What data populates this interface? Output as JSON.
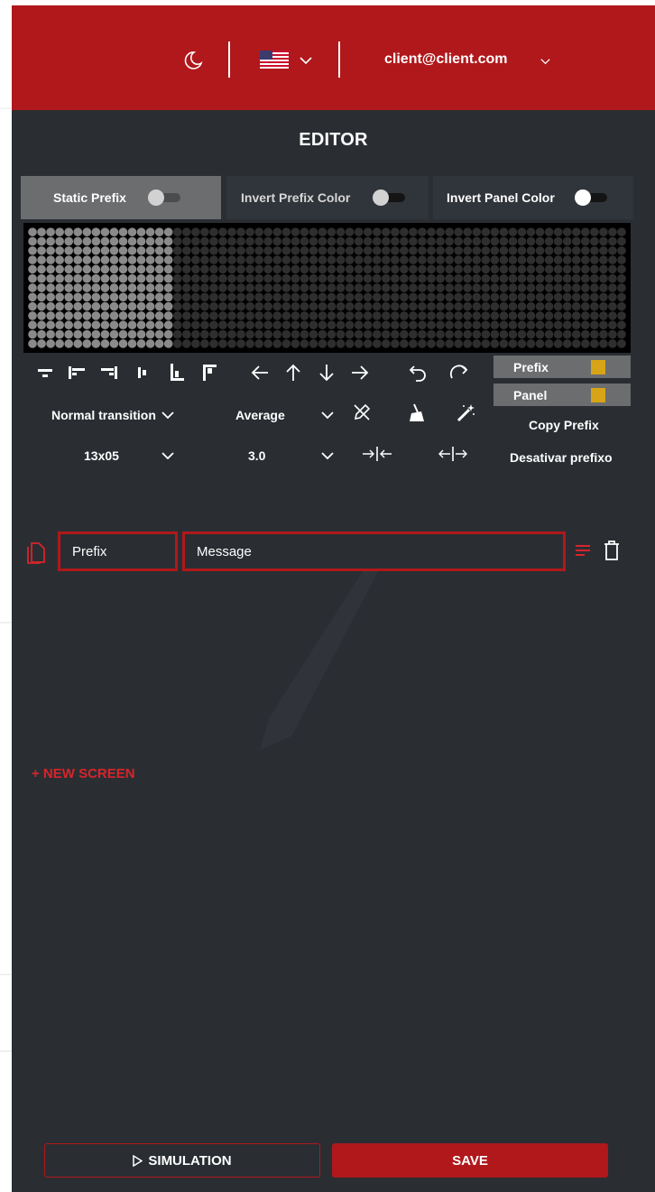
{
  "header": {
    "theme_icon": "moon-icon",
    "language_icon": "us-flag-icon",
    "user_email": "client@client.com",
    "colors": {
      "bar": "#b0181b"
    }
  },
  "editor": {
    "title": "EDITOR",
    "toggles": [
      {
        "label": "Static Prefix",
        "on": false,
        "active": true
      },
      {
        "label": "Invert Prefix Color",
        "on": false,
        "active": false
      },
      {
        "label": "Invert Panel Color",
        "on": false,
        "active": false
      }
    ],
    "led_panel": {
      "columns": 66,
      "rows": 13,
      "prefix_columns": 16,
      "prefix_dot_color": "#8a8a8a",
      "off_dot_color": "#2e2e2e"
    },
    "toolbar_icons": [
      "align-bottom-center-icon",
      "align-left-icon",
      "align-right-icon",
      "align-middle-left-icon",
      "align-bottom-left-icon",
      "align-top-left-icon",
      "arrow-left-icon",
      "arrow-up-icon",
      "arrow-down-icon",
      "arrow-right-icon",
      "undo-icon",
      "redo-icon"
    ],
    "colors": {
      "prefix_label": "Prefix",
      "panel_label": "Panel",
      "prefix_color": "#d8a417",
      "panel_color": "#d8a417"
    },
    "transition": "Normal transition",
    "speed": "Average",
    "size": "13x05",
    "duration": "3.0",
    "tool_icons": [
      "pencil-off-icon",
      "broom-icon",
      "magic-wand-icon",
      "compress-horizontal-icon",
      "expand-horizontal-icon"
    ],
    "copy_prefix": "Copy Prefix",
    "disable_prefix": "Desativar prefixo"
  },
  "screen": {
    "prefix_placeholder": "Prefix",
    "message_placeholder": "Message",
    "copy_icon": "copy-icon",
    "align_icon": "align-lines-icon",
    "delete_icon": "trash-icon"
  },
  "new_screen": "+ NEW SCREEN",
  "footer": {
    "simulation": "SIMULATION",
    "save": "SAVE"
  }
}
